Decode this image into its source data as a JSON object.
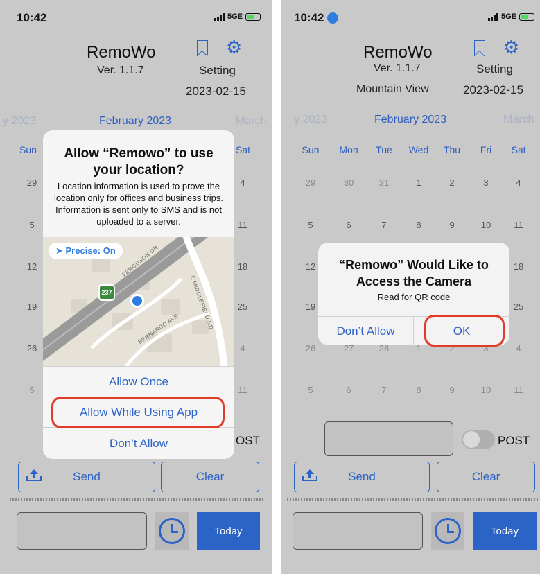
{
  "screens": [
    {
      "status": {
        "time": "10:42",
        "network": "5GE"
      },
      "app": {
        "title": "RemoWo",
        "version": "Ver. 1.1.7",
        "setting": "Setting",
        "date": "2023-02-15"
      },
      "calendar": {
        "prev_month": "y 2023",
        "month": "February 2023",
        "next_month": "March",
        "weekdays": [
          "Sun",
          "Sat"
        ],
        "left_col": [
          "29",
          "5",
          "12",
          "19",
          "26",
          "5"
        ],
        "right_col": [
          "4",
          "11",
          "18",
          "25",
          "4",
          "11"
        ]
      },
      "post_partial": "OST",
      "actions": {
        "send": "Send",
        "clear": "Clear",
        "today": "Today"
      },
      "alert": {
        "title": "Allow “Remowo” to use your location?",
        "message": "Location information is used to prove the location only for offices and business trips. Information is sent only to SMS and is not uploaded to a server.",
        "precise": "Precise: On",
        "map_labels": [
          "FERGUSON DR",
          "E MIDDLEFIELD RD",
          "BERNARDO AVE",
          "237"
        ],
        "buttons": [
          "Allow Once",
          "Allow While Using App",
          "Don’t Allow"
        ]
      }
    },
    {
      "status": {
        "time": "10:42",
        "network": "5GE"
      },
      "app": {
        "title": "RemoWo",
        "version": "Ver. 1.1.7",
        "setting": "Setting",
        "date": "2023-02-15",
        "location": "Mountain View"
      },
      "calendar": {
        "prev_month": "y 2023",
        "month": "February 2023",
        "next_month": "March",
        "weekdays": [
          "Sun",
          "Mon",
          "Tue",
          "Wed",
          "Thu",
          "Fri",
          "Sat"
        ],
        "weeks": [
          [
            "29",
            "30",
            "31",
            "1",
            "2",
            "3",
            "4"
          ],
          [
            "5",
            "6",
            "7",
            "8",
            "9",
            "10",
            "11"
          ],
          [
            "12",
            "",
            "",
            "",
            "",
            "",
            "18"
          ],
          [
            "19",
            "",
            "",
            "",
            "",
            "",
            "25"
          ],
          [
            "26",
            "27",
            "28",
            "1",
            "2",
            "3",
            "4"
          ],
          [
            "5",
            "6",
            "7",
            "8",
            "9",
            "10",
            "11"
          ]
        ]
      },
      "post": "POST",
      "actions": {
        "send": "Send",
        "clear": "Clear",
        "today": "Today"
      },
      "alert": {
        "title": "“Remowo” Would Like to Access the Camera",
        "message": "Read for QR code",
        "buttons": [
          "Don’t Allow",
          "OK"
        ]
      }
    }
  ],
  "colors": {
    "accent": "#2c63c7",
    "highlight": "#e23b2a",
    "background": "#c9c9c9"
  }
}
